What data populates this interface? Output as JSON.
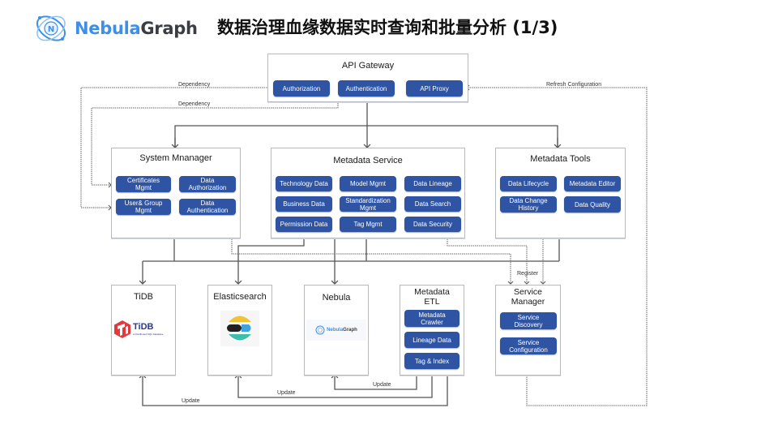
{
  "header": {
    "logo_part1": "Nebula",
    "logo_part2": "Graph",
    "title": "数据治理血缘数据实时查询和批量分析 (1/3)"
  },
  "colors": {
    "pill_bg": "#2e54a3",
    "logo_blue": "#3d8fe8",
    "logo_dark": "#3a3d44",
    "line": "#555555",
    "tidb_red": "#e03a3e",
    "es_yellow": "#f0c23a",
    "es_blue": "#3fa2df",
    "es_teal": "#3dbea8"
  },
  "api_gateway": {
    "title": "API Gateway",
    "items": [
      "Authorization",
      "Authentication",
      "API Proxy"
    ]
  },
  "system_manager": {
    "title": "System Mnanager",
    "items": [
      "Certificates\nMgmt",
      "Data\nAuthorization",
      "User& Group\nMgmt",
      "Data\nAuthentication"
    ]
  },
  "metadata_service": {
    "title": "Metadata Service",
    "items": [
      "Technology Data",
      "Model Mgmt",
      "Data Lineage",
      "Business Data",
      "Standardization\nMgmt",
      "Data Search",
      "Permission Data",
      "Tag Mgmt",
      "Data Security"
    ]
  },
  "metadata_tools": {
    "title": "Metadata Tools",
    "items": [
      "Data Lifecycle",
      "Metadata Editor",
      "Data Change\nHistory",
      "Data Quality"
    ]
  },
  "tidb": {
    "title": "TiDB",
    "logo_text": "TiDB",
    "logo_sub": "A Distributed SQL Database"
  },
  "elasticsearch": {
    "title": "Elasticsearch"
  },
  "nebula": {
    "title": "Nebula",
    "logo_part1": "Nebula",
    "logo_part2": "Graph"
  },
  "metadata_etl": {
    "title": "Metadata\nETL",
    "items": [
      "Metadata\nCrawler",
      "Lineage Data",
      "Tag & Index"
    ]
  },
  "service_manager": {
    "title": "Service\nManager",
    "items": [
      "Service\nDiscovery",
      "Service\nConfiguration"
    ]
  },
  "edge_labels": {
    "dependency_1": "Dependency",
    "dependency_2": "Dependency",
    "refresh": "Refresh Configuration",
    "register": "Register",
    "update_1": "Update",
    "update_2": "Update",
    "update_3": "Update"
  }
}
